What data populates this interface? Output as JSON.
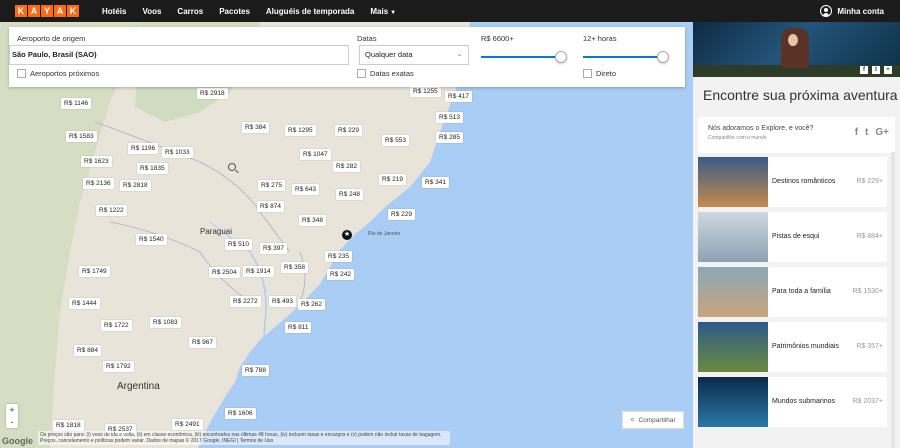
{
  "nav": {
    "logo_letters": [
      "K",
      "A",
      "Y",
      "A",
      "K"
    ],
    "links": [
      "Hotéis",
      "Voos",
      "Carros",
      "Pacotes",
      "Aluguéis de temporada",
      "Mais"
    ],
    "account": "Minha conta"
  },
  "search": {
    "origin_label": "Aeroporto de origem",
    "origin_value": "São Paulo, Brasil (SAO)",
    "nearby_label": "Aeroportos próximos",
    "dates_label": "Datas",
    "dates_value": "Qualquer data",
    "exact_label": "Datas exatas",
    "price_label": "R$ 6600+",
    "price_fraction": 1.0,
    "hours_label": "12+ horas",
    "hours_fraction": 1.0,
    "direct_label": "Direto"
  },
  "map": {
    "labels": {
      "paraguai": "Paraguai",
      "argentina": "Argentina",
      "rio": "Rio de Janeiro"
    },
    "prices": [
      "R$ 2918",
      "R$ 1146",
      "R$ 384",
      "R$ 1295",
      "R$ 229",
      "R$ 1255",
      "R$ 417",
      "R$ 513",
      "R$ 1583",
      "R$ 553",
      "R$ 285",
      "R$ 1196",
      "R$ 1033",
      "R$ 1047",
      "R$ 1623",
      "R$ 1835",
      "R$ 282",
      "R$ 2136",
      "R$ 2818",
      "R$ 275",
      "R$ 643",
      "R$ 219",
      "R$ 341",
      "R$ 248",
      "R$ 874",
      "R$ 1222",
      "R$ 229",
      "R$ 348",
      "R$ 1540",
      "R$ 510",
      "R$ 397",
      "R$ 235",
      "R$ 1749",
      "R$ 2504",
      "R$ 1914",
      "R$ 358",
      "R$ 242",
      "R$ 1444",
      "R$ 2272",
      "R$ 493",
      "R$ 262",
      "R$ 1722",
      "R$ 1083",
      "R$ 811",
      "R$ 967",
      "R$ 884",
      "R$ 1792",
      "R$ 788",
      "R$ 1606",
      "R$ 1818",
      "R$ 2537",
      "R$ 2491"
    ],
    "zoom_in": "+",
    "zoom_out": "-",
    "share_label": "Compartilhar",
    "disclaimer": "Os preços são para: (i) voos de ida e volta, (ii) em classe econômica, (iii) encontrados nas últimas 48 horas, (iv) incluem taxas e encargos e (v) podem não incluir taxas de bagagem. Preços, cancelamento e políticas podem variar. Dados de mapas © 2017 Google, INEGI | Termos de Uso",
    "google": "Google"
  },
  "panel": {
    "title": "Encontre sua próxima aventura",
    "explore_text": "Nós adoramos o Explore, e você?",
    "explore_sub": "Compartilhe com o mundo",
    "hero_social": [
      "f",
      "t",
      "+"
    ],
    "explore_social": [
      "f",
      "t",
      "G+"
    ],
    "cards": [
      {
        "label": "Destinos românticos",
        "price": "R$ 229+",
        "colors": [
          "#3a5c86",
          "#c68a4c"
        ]
      },
      {
        "label": "Pistas de esqui",
        "price": "R$ 884+",
        "colors": [
          "#cfd8df",
          "#8ea2b4"
        ]
      },
      {
        "label": "Para toda a família",
        "price": "R$ 1530+",
        "colors": [
          "#8aa8b8",
          "#c8a57a"
        ]
      },
      {
        "label": "Patrimônios mundiais",
        "price": "R$ 357+",
        "colors": [
          "#2c5a8a",
          "#6b8a3f"
        ]
      },
      {
        "label": "Mundos submarinos",
        "price": "R$ 2037+",
        "colors": [
          "#0b2a4a",
          "#2a78a8"
        ]
      }
    ]
  }
}
